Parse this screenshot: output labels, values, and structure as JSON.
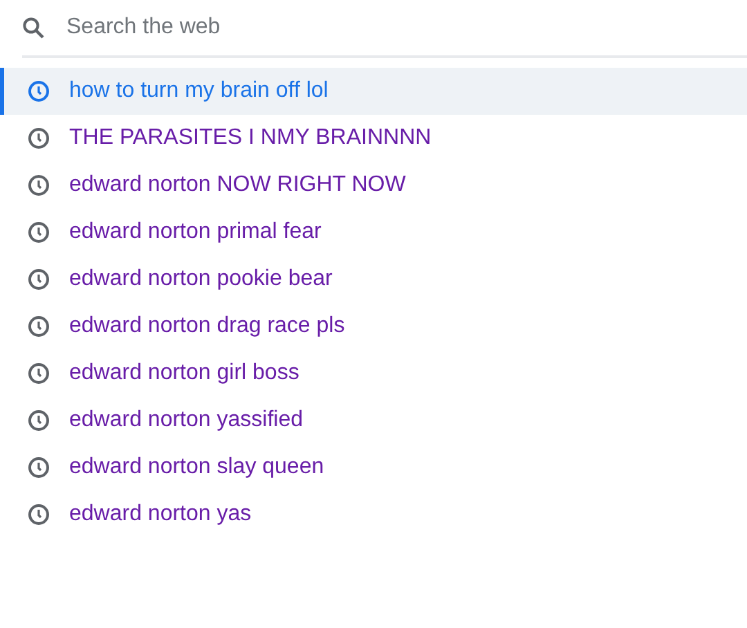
{
  "search": {
    "placeholder": "Search the web"
  },
  "suggestions": [
    {
      "text": "how to turn my brain off lol",
      "selected": true
    },
    {
      "text": "THE PARASITES I NMY BRAINNNN",
      "selected": false
    },
    {
      "text": "edward norton NOW RIGHT NOW",
      "selected": false
    },
    {
      "text": "edward norton primal fear",
      "selected": false
    },
    {
      "text": "edward norton pookie bear",
      "selected": false
    },
    {
      "text": "edward norton drag race pls",
      "selected": false
    },
    {
      "text": "edward norton girl boss",
      "selected": false
    },
    {
      "text": "edward norton yassified",
      "selected": false
    },
    {
      "text": "edward norton slay queen",
      "selected": false
    },
    {
      "text": "edward norton yas",
      "selected": false
    }
  ]
}
